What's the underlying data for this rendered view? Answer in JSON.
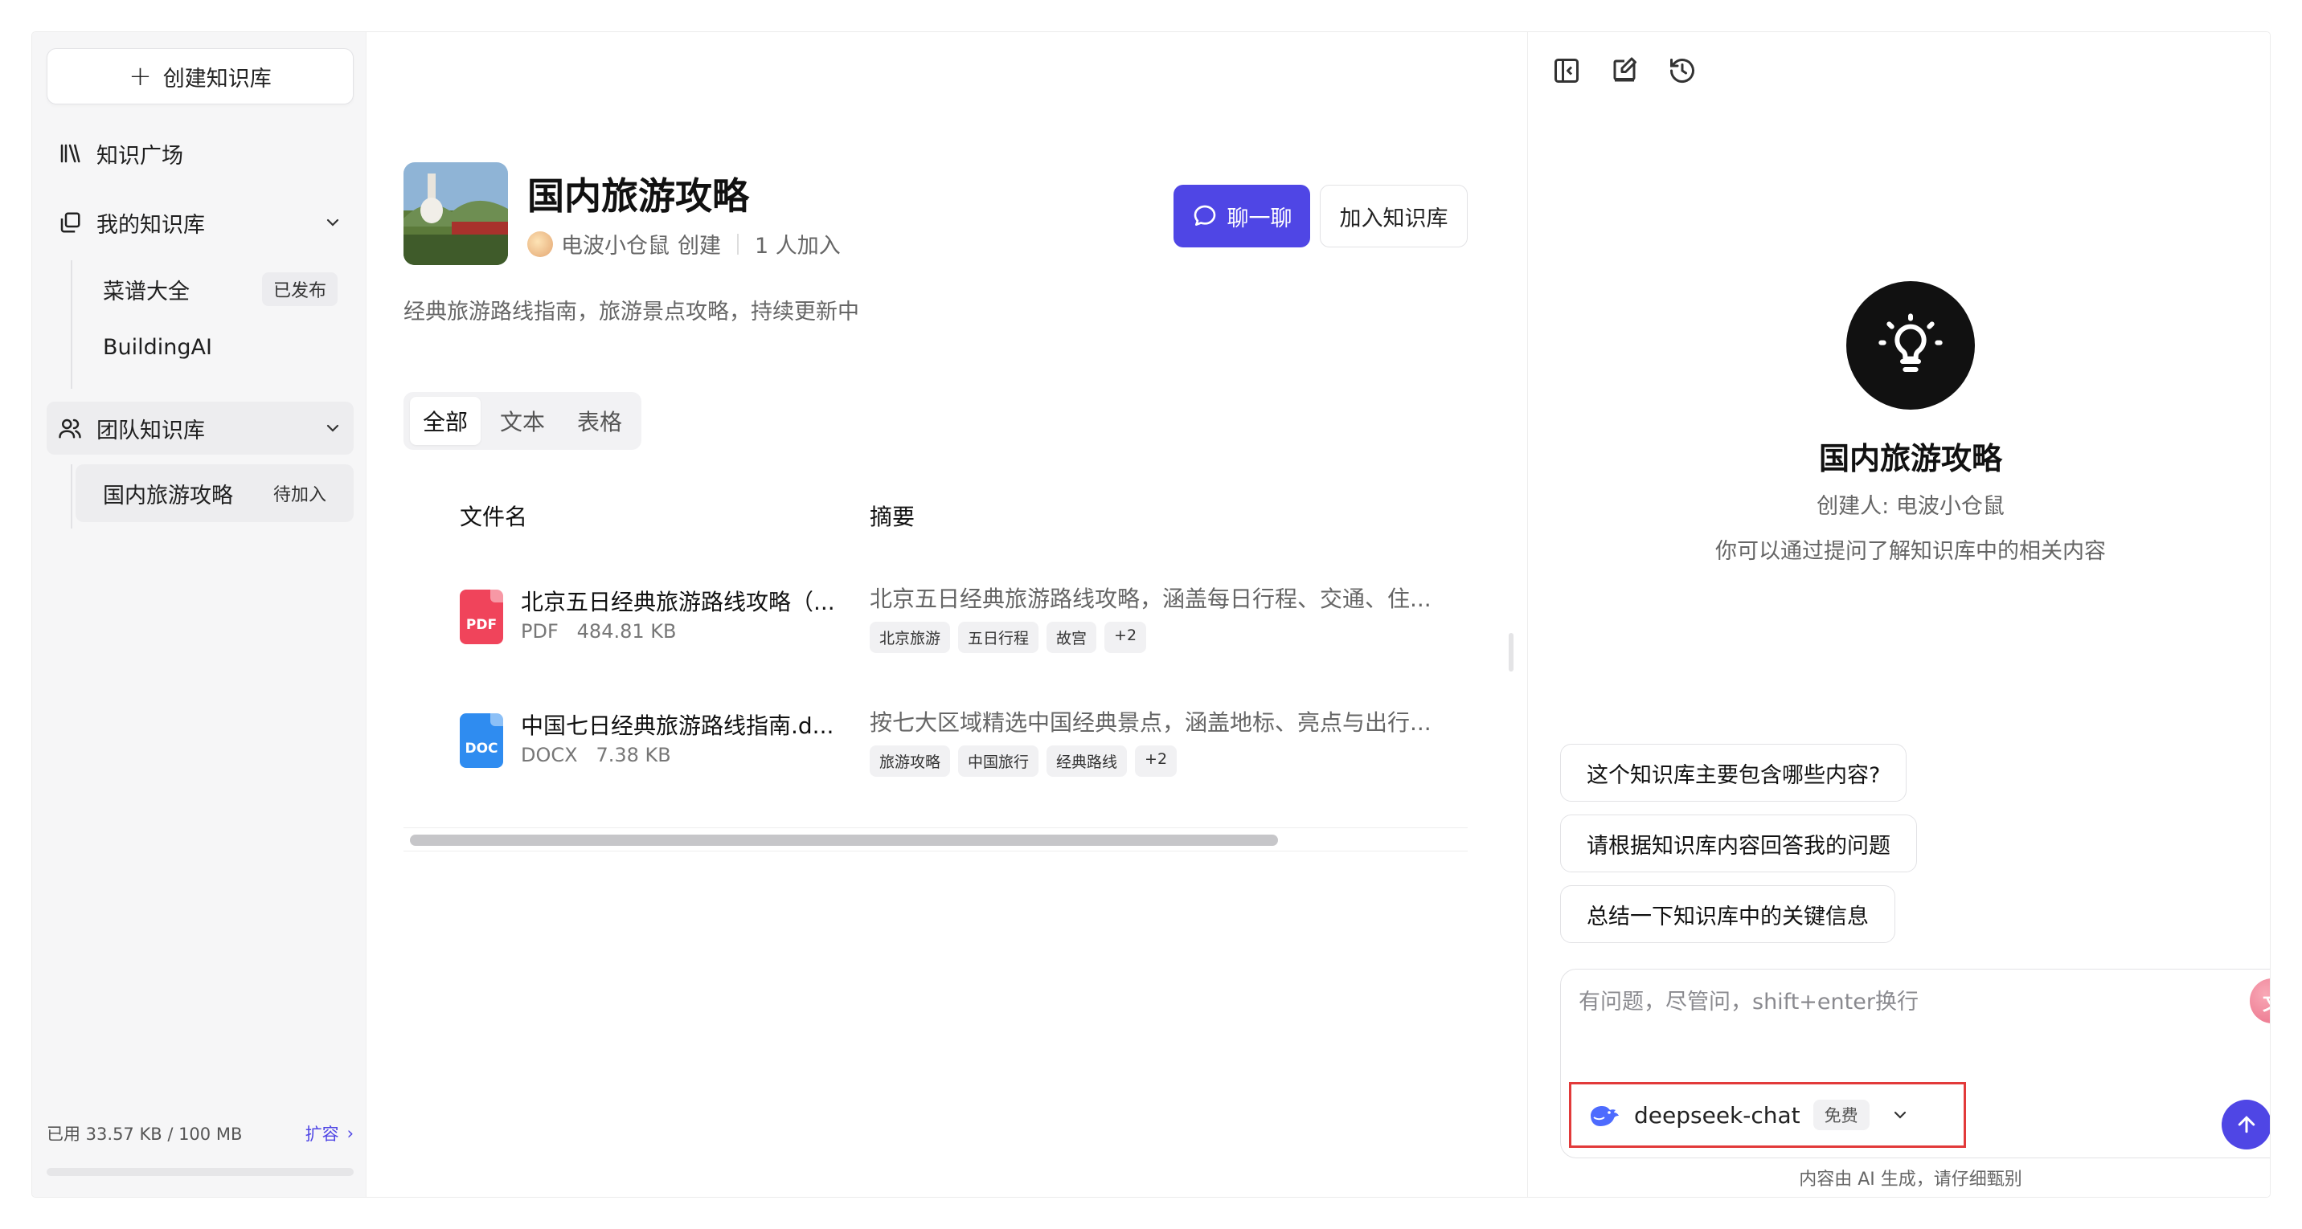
{
  "sidebar": {
    "create_label": "创建知识库",
    "plaza_label": "知识广场",
    "my_kb_label": "我的知识库",
    "my_kb_items": [
      {
        "label": "菜谱大全",
        "badge": "已发布"
      },
      {
        "label": "BuildingAI",
        "badge": ""
      }
    ],
    "team_kb_label": "团队知识库",
    "team_kb_items": [
      {
        "label": "国内旅游攻略",
        "badge": "待加入"
      }
    ],
    "storage_text": "已用 33.57 KB / 100 MB",
    "expand_label": "扩容"
  },
  "main": {
    "title": "国内旅游攻略",
    "creator_name": "电波小仓鼠",
    "created_label": "创建",
    "members": "1 人加入",
    "chat_label": "聊一聊",
    "join_label": "加入知识库",
    "description": "经典旅游路线指南，旅游景点攻略，持续更新中",
    "tabs": [
      {
        "label": "全部"
      },
      {
        "label": "文本"
      },
      {
        "label": "表格"
      }
    ],
    "columns": {
      "name": "文件名",
      "summary": "摘要"
    },
    "files": [
      {
        "name": "北京五日经典旅游路线攻略（...",
        "type": "PDF",
        "size": "484.81 KB",
        "icon_label": "PDF",
        "icon_color": "#f0445b",
        "summary": "北京五日经典旅游路线攻略，涵盖每日行程、交通、住...",
        "tags": [
          "北京旅游",
          "五日行程",
          "故宫",
          "+2"
        ]
      },
      {
        "name": "中国七日经典旅游路线指南.d...",
        "type": "DOCX",
        "size": "7.38 KB",
        "icon_label": "DOC",
        "icon_color": "#2f8cf0",
        "summary": "按七大区域精选中国经典景点，涵盖地标、亮点与出行...",
        "tags": [
          "旅游攻略",
          "中国旅行",
          "经典路线",
          "+2"
        ]
      }
    ]
  },
  "panel": {
    "title": "国内旅游攻略",
    "creator": "创建人: 电波小仓鼠",
    "hint": "你可以通过提问了解知识库中的相关内容",
    "suggestions": [
      "这个知识库主要包含哪些内容?",
      "请根据知识库内容回答我的问题",
      "总结一下知识库中的关键信息"
    ],
    "input_placeholder": "有问题，尽管问，shift+enter换行",
    "model_name": "deepseek-chat",
    "model_badge": "免费",
    "disclaimer": "内容由 AI 生成，请仔细甄别"
  },
  "colors": {
    "accent": "#4f46e5",
    "highlight_border": "#e23a3a"
  }
}
